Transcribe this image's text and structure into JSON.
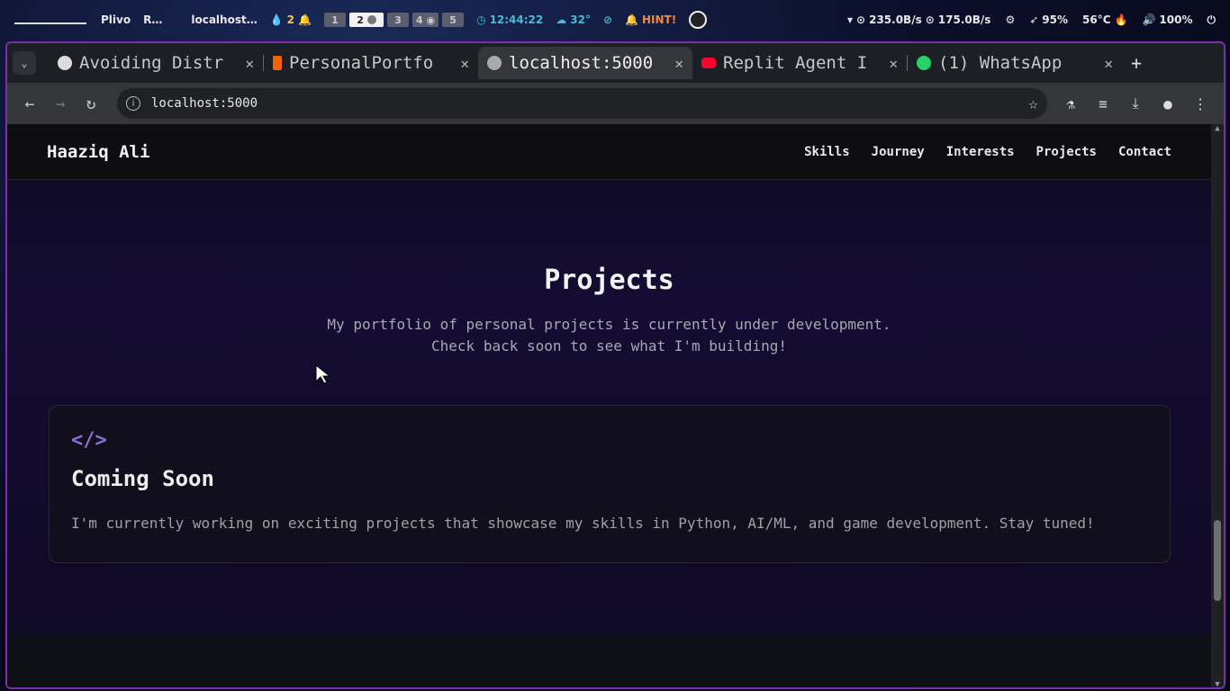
{
  "sysbar": {
    "workspace_app1": "Plivo",
    "workspace_app2": "R…",
    "window_title": "localhost…",
    "notif_count": "2",
    "workspaces": [
      "1",
      "2",
      "3",
      "4",
      "5"
    ],
    "clock": "12:44:22",
    "weather": "32°",
    "hint": "HINT!",
    "net_down": "235.0B/s",
    "net_up": "175.0B/s",
    "cpu": "95%",
    "temp": "56°C",
    "volume": "100%"
  },
  "tabs": [
    {
      "title": "Avoiding Distr",
      "active": false
    },
    {
      "title": "PersonalPortfo",
      "active": false
    },
    {
      "title": "localhost:5000",
      "active": true
    },
    {
      "title": "Replit Agent I",
      "active": false
    },
    {
      "title": "(1) WhatsApp",
      "active": false
    }
  ],
  "toolbar": {
    "url": "localhost:5000"
  },
  "site": {
    "brand": "Haaziq Ali",
    "nav": [
      "Skills",
      "Journey",
      "Interests",
      "Projects",
      "Contact"
    ],
    "section_title": "Projects",
    "section_line1": "My portfolio of personal projects is currently under development.",
    "section_line2": "Check back soon to see what I'm building!",
    "card": {
      "icon": "</>",
      "title": "Coming Soon",
      "desc": "I'm currently working on exciting projects that showcase my skills in Python, AI/ML, and game development. Stay tuned!"
    }
  },
  "colors": {
    "accent_purple": "#8b6fd9",
    "frame_border": "#7a2fae"
  }
}
